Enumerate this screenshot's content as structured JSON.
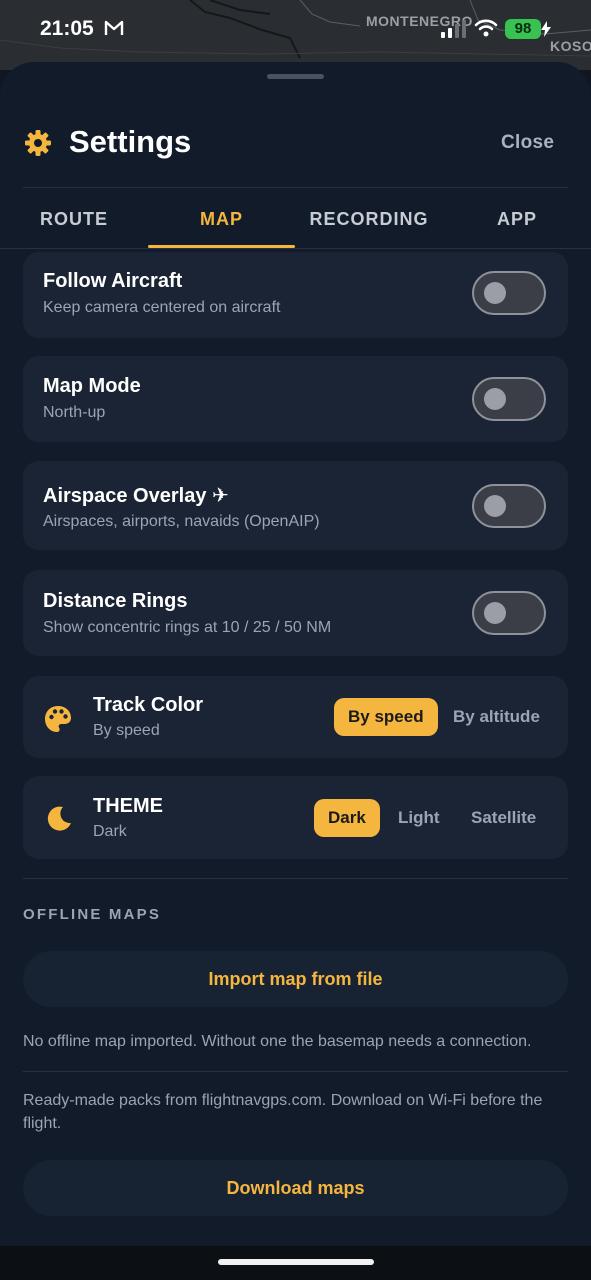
{
  "status_bar": {
    "time": "21:05",
    "map_label_1": "MONTENEGRO",
    "map_label_2": "KOSO",
    "battery": "98"
  },
  "header": {
    "title": "Settings",
    "close_label": "Close"
  },
  "tabs": [
    {
      "label": "ROUTE",
      "active": false
    },
    {
      "label": "MAP",
      "active": true
    },
    {
      "label": "RECORDING",
      "active": false
    },
    {
      "label": "APP",
      "active": false
    }
  ],
  "settings": {
    "follow_aircraft": {
      "title": "Follow Aircraft",
      "subtitle": "Keep camera centered on aircraft",
      "enabled": false
    },
    "map_mode": {
      "title": "Map Mode",
      "subtitle": "North-up",
      "enabled": false
    },
    "airspace_overlay": {
      "title": "Airspace Overlay ✈",
      "subtitle": "Airspaces, airports, navaids (OpenAIP)",
      "enabled": false
    },
    "distance_rings": {
      "title": "Distance Rings",
      "subtitle": "Show concentric rings at 10 / 25 / 50 NM",
      "enabled": false
    },
    "track_color": {
      "title": "Track Color",
      "subtitle": "By speed",
      "options": [
        "By speed",
        "By altitude"
      ],
      "selected": "By speed"
    },
    "theme": {
      "title": "THEME",
      "subtitle": "Dark",
      "options": [
        "Dark",
        "Light",
        "Satellite"
      ],
      "selected": "Dark"
    }
  },
  "offline_maps": {
    "section_label": "OFFLINE MAPS",
    "import_label": "Import map from file",
    "import_note": "No offline map imported. Without one the basemap needs a connection.",
    "packs_note": "Ready-made packs from flightnavgps.com. Download on Wi-Fi before the flight.",
    "download_label": "Download maps"
  },
  "colors": {
    "accent": "#f4b63f",
    "background": "#121b29",
    "card": "#1a2434"
  }
}
